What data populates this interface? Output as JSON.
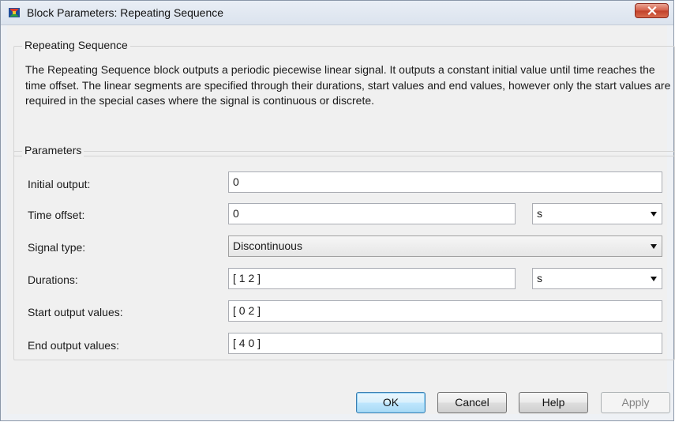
{
  "window": {
    "title": "Block Parameters: Repeating Sequence"
  },
  "block": {
    "group_label": "Repeating Sequence",
    "description": "The Repeating Sequence block outputs a periodic piecewise linear signal. It outputs a constant initial value until time reaches the time offset. The linear segments are specified through their durations, start values and end values, however only the start values are required in the special cases where the signal is continuous or discrete."
  },
  "parameters": {
    "group_label": "Parameters",
    "initial_output": {
      "label": "Initial output:",
      "value": "0"
    },
    "time_offset": {
      "label": "Time offset:",
      "value": "0",
      "unit": "s"
    },
    "signal_type": {
      "label": "Signal type:",
      "value": "Discontinuous"
    },
    "durations": {
      "label": "Durations:",
      "value": "[ 1 2 ]",
      "unit": "s"
    },
    "start_output_values": {
      "label": "Start output values:",
      "value": "[ 0 2 ]"
    },
    "end_output_values": {
      "label": "End output values:",
      "value": "[ 4 0 ]"
    }
  },
  "buttons": {
    "ok": "OK",
    "cancel": "Cancel",
    "help": "Help",
    "apply": "Apply"
  },
  "colors": {
    "close_button": "#c1412a",
    "default_button_border": "#3c7fb1"
  }
}
